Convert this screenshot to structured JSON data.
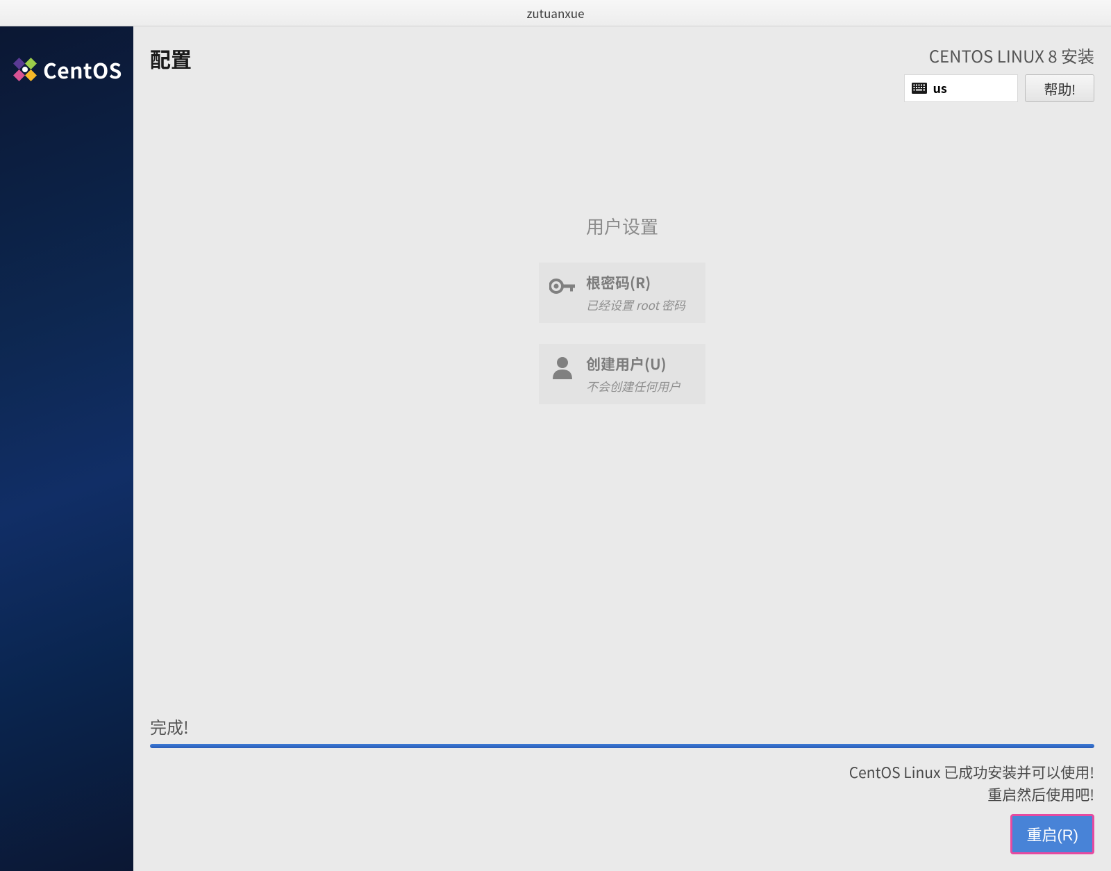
{
  "window": {
    "title": "zutuanxue"
  },
  "brand": {
    "name": "CentOS"
  },
  "header": {
    "page_title": "配置",
    "install_title": "CENTOS LINUX 8 安装",
    "keyboard_layout": "us",
    "help_label": "帮助!"
  },
  "user_settings": {
    "section_title": "用户设置",
    "root_password": {
      "title": "根密码(R)",
      "desc": "已经设置 root 密码"
    },
    "create_user": {
      "title": "创建用户(U)",
      "desc": "不会创建任何用户"
    }
  },
  "progress": {
    "label": "完成!",
    "percent": 100
  },
  "status": {
    "line1": "CentOS Linux 已成功安装并可以使用!",
    "line2": "重启然后使用吧!"
  },
  "reboot": {
    "label": "重启(R)"
  }
}
